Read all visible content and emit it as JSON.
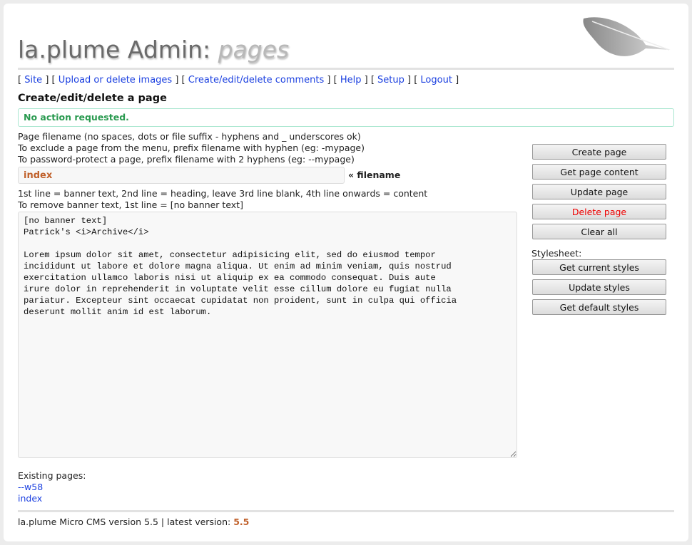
{
  "header": {
    "title": "la.plume Admin:",
    "section": "pages"
  },
  "nav": [
    {
      "label": "Site"
    },
    {
      "label": "Upload or delete images"
    },
    {
      "label": "Create/edit/delete comments"
    },
    {
      "label": "Help"
    },
    {
      "label": "Setup"
    },
    {
      "label": "Logout"
    }
  ],
  "heading": "Create/edit/delete a page",
  "status": "No action requested.",
  "help": [
    "Page filename (no spaces, dots or file suffix - hyphens and _ underscores ok)",
    "To exclude a page from the menu, prefix filename with hyphen (eg: -mypage)",
    "To password-protect a page, prefix filename with 2 hyphens (eg: --mypage)"
  ],
  "filename": {
    "value": "index",
    "label": "« filename"
  },
  "help2": [
    "1st line = banner text, 2nd line = heading, leave 3rd line blank, 4th line onwards = content",
    "To remove banner text, 1st line = [no banner text]"
  ],
  "content": "[no banner text]\nPatrick's <i>Archive</i>\n\nLorem ipsum dolor sit amet, consectetur adipisicing elit, sed do eiusmod tempor\nincididunt ut labore et dolore magna aliqua. Ut enim ad minim veniam, quis nostrud\nexercitation ullamco laboris nisi ut aliquip ex ea commodo consequat. Duis aute\nirure dolor in reprehenderit in voluptate velit esse cillum dolore eu fugiat nulla\npariatur. Excepteur sint occaecat cupidatat non proident, sunt in culpa qui officia\ndeserunt mollit anim id est laborum.",
  "buttons": {
    "create": "Create page",
    "get": "Get page content",
    "update": "Update page",
    "delete": "Delete page",
    "clear": "Clear all",
    "stylesheet_label": "Stylesheet:",
    "get_styles": "Get current styles",
    "update_styles": "Update styles",
    "default_styles": "Get default styles"
  },
  "existing": {
    "label": "Existing pages:",
    "pages": [
      "--w58",
      "index"
    ]
  },
  "footer": {
    "text": "la.plume Micro CMS version 5.5 | latest version:",
    "latest": "5.5"
  }
}
